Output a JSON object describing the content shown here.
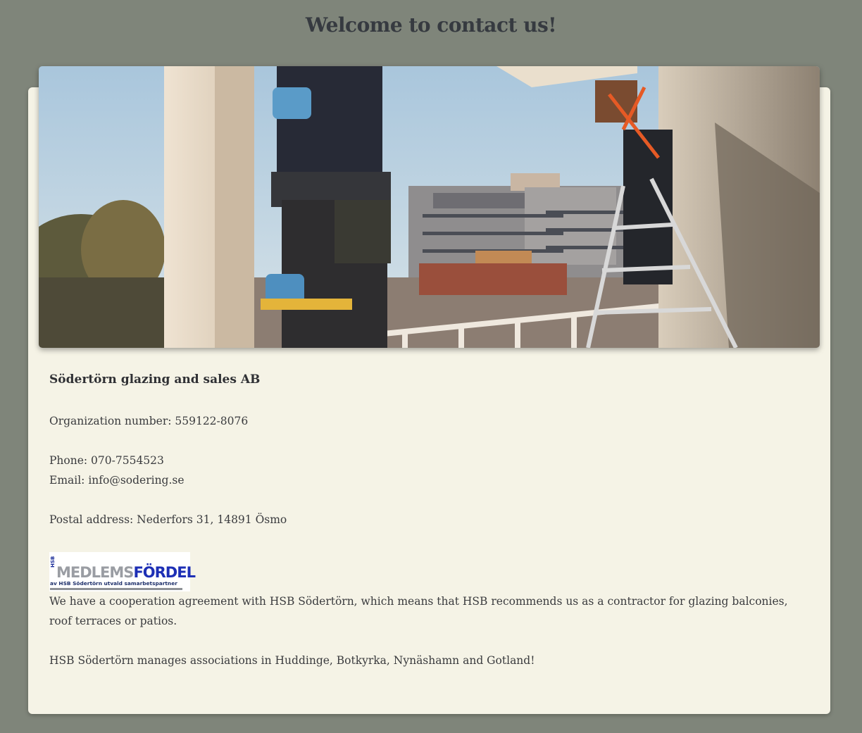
{
  "page": {
    "title": "Welcome to contact us!"
  },
  "company": {
    "name": "Södertörn glazing and sales AB",
    "organization_number": "Organization number: 559122-8076",
    "phone": "Phone: 070-7554523",
    "email": "Email: info@sodering.se",
    "postal_address": "Postal address: Nederfors 31, 14891 Ösmo"
  },
  "partner_logo": {
    "side_text": "HSB",
    "main_grey": "MEDLEMS",
    "main_blue": "FÖRDEL",
    "subtitle": "av HSB Södertörn utvald samarbetspartner"
  },
  "cooperation": {
    "text": "We have a cooperation agreement with HSB Södertörn, which means that HSB recommends us as a contractor for glazing balconies, roof terraces or patios.",
    "associations": "HSB Södertörn manages associations in Huddinge, Botkyrka, Nynäshamn and Gotland!"
  },
  "colors": {
    "background": "#7f857a",
    "card": "#f5f3e6",
    "text": "#3a3b3e"
  }
}
